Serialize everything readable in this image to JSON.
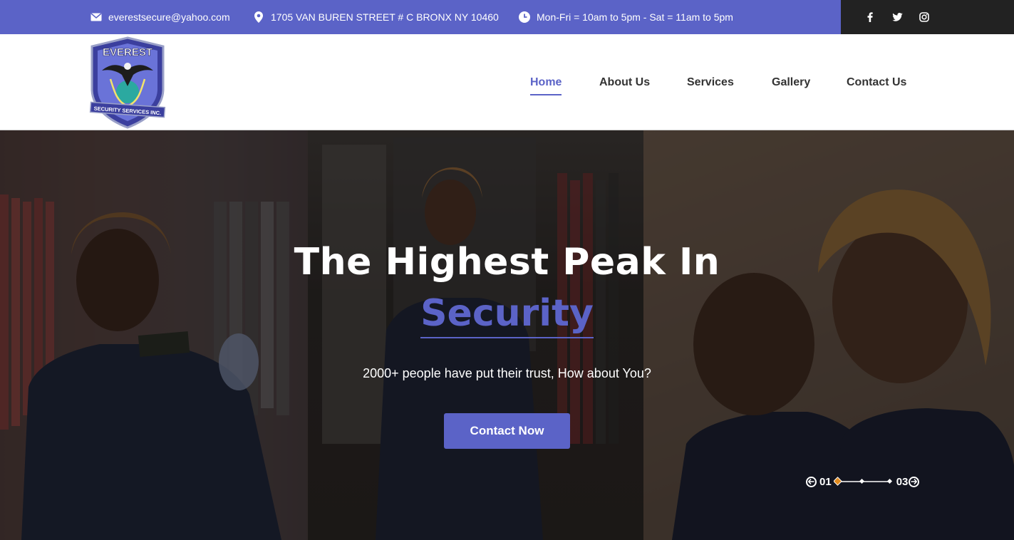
{
  "topbar": {
    "email": "everestsecure@yahoo.com",
    "address": "1705 VAN BUREN STREET # C BRONX NY 10460",
    "hours": "Mon-Fri = 10am to 5pm - Sat = 11am to 5pm",
    "icons": [
      "envelope-icon",
      "map-pin-icon",
      "clock-icon"
    ],
    "social": [
      {
        "name": "facebook-icon",
        "glyph": "f"
      },
      {
        "name": "twitter-icon",
        "glyph": "t"
      },
      {
        "name": "instagram-icon",
        "glyph": "ig"
      }
    ]
  },
  "logo": {
    "top_text": "EVEREST",
    "bottom_text": "SECURITY SERVICES INC."
  },
  "nav": {
    "items": [
      {
        "label": "Home",
        "active": true
      },
      {
        "label": "About Us",
        "active": false
      },
      {
        "label": "Services",
        "active": false
      },
      {
        "label": "Gallery",
        "active": false
      },
      {
        "label": "Contact Us",
        "active": false
      }
    ]
  },
  "hero": {
    "title": "The Highest Peak In",
    "accent": "Security",
    "subtitle": "2000+ people have put their trust, How about You?",
    "button": "Contact Now",
    "slider_current": "01",
    "slider_total": "03"
  },
  "colors": {
    "brand": "#5b63c7",
    "dark": "#222222",
    "slider_active": "#e08a1e"
  }
}
